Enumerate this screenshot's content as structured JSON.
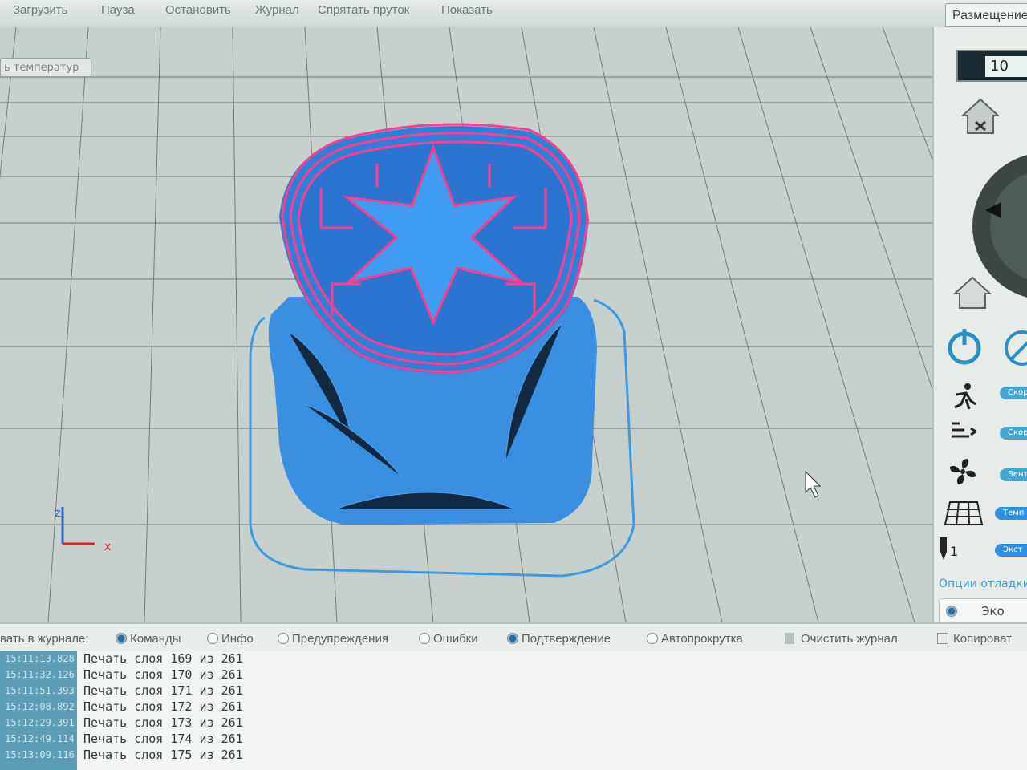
{
  "toolbar": {
    "load": "Загрузить",
    "pause": "Пауза",
    "stop": "Остановить",
    "journal": "Журнал",
    "hide_filament": "Спрятать пруток",
    "show": "Показать"
  },
  "tabs": {
    "temperature": "ь температур",
    "placement": "Размещение"
  },
  "viewport": {
    "axis_z": "z",
    "axis_x": "x"
  },
  "panel": {
    "position_value": "10",
    "labels": [
      "Скор",
      "Скор",
      "Вент",
      "Темп",
      "Экст"
    ],
    "extruder": "1",
    "debug_options": "Опции отладки",
    "eco": "Эко"
  },
  "log_options": {
    "show_in_log": "вать в журнале:",
    "commands": "Команды",
    "info": "Инфо",
    "warnings": "Предупреждения",
    "errors": "Ошибки",
    "confirmation": "Подтверждение",
    "autoscroll": "Автопрокрутка",
    "clear_log": "Очистить журнал",
    "copy": "Копироват"
  },
  "log": [
    {
      "time": "15:11:13.828",
      "text": "Печать слоя 169 из 261"
    },
    {
      "time": "15:11:32.126",
      "text": "Печать слоя 170 из 261"
    },
    {
      "time": "15:11:51.393",
      "text": "Печать слоя 171 из 261"
    },
    {
      "time": "15:12:08.892",
      "text": "Печать слоя 172 из 261"
    },
    {
      "time": "15:12:29.391",
      "text": "Печать слоя 173 из 261"
    },
    {
      "time": "15:12:49.114",
      "text": "Печать слоя 174 из 261"
    },
    {
      "time": "15:13:09.116",
      "text": "Печать слоя 175 из 261"
    }
  ],
  "colors": {
    "model_blue": "#2f86e0",
    "layer_pink": "#ff3d8e",
    "accent": "#45a6d6"
  }
}
